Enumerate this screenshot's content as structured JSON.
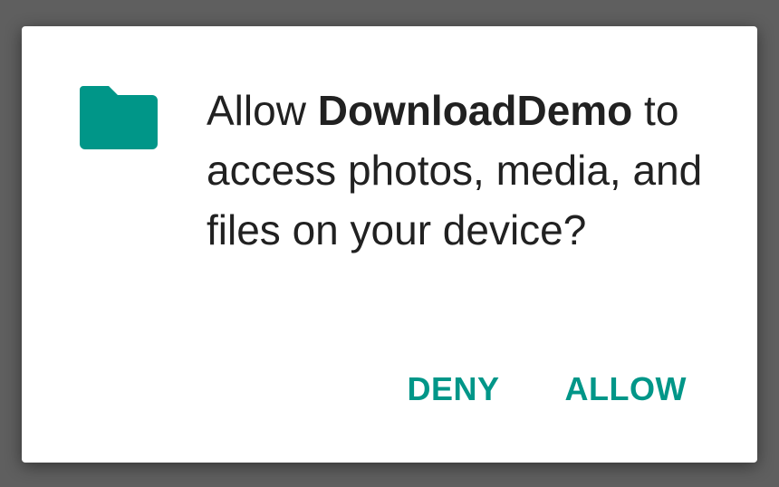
{
  "dialog": {
    "icon": "folder-icon",
    "message_prefix": "Allow ",
    "app_name": "DownloadDemo",
    "message_suffix": " to access photos, media, and files on your device?",
    "buttons": {
      "deny_label": "DENY",
      "allow_label": "ALLOW"
    }
  },
  "colors": {
    "accent": "#009688",
    "text": "#212121",
    "scrim": "#5f5f5f",
    "dialog_bg": "#ffffff"
  }
}
